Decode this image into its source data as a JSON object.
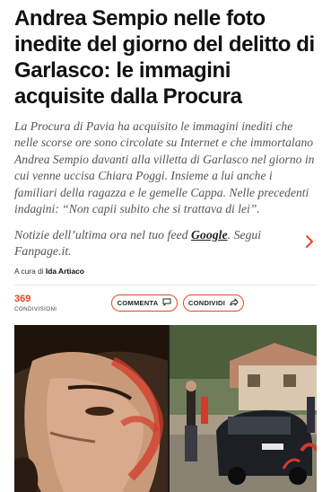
{
  "article": {
    "headline": "Andrea Sempio nelle foto inedite del giorno del delitto di Garlasco: le immagini acquisite dalla Procura",
    "summary": "La Procura di Pavia ha acquisito le immagini inediti che nelle scorse ore sono circolate su Internet e che immortalano Andrea Sempio davanti alla villetta di Garlasco nel giorno in cui venne uccisa Chiara Poggi. Insieme a lui anche i familiari della ragazza e le gemelle Cappa. Nelle precedenti indagini: “Non capii subito che si trattava di lei”.",
    "notify": {
      "prefix": "Notizie dell’ultima ora nel tuo feed ",
      "google": "Google",
      "suffix": ". Segui Fanpage.it."
    },
    "byline": {
      "prefix": "A cura di ",
      "author": "Ida Artiaco"
    }
  },
  "social": {
    "share_count": "369",
    "share_label": "CONDIVISIONI",
    "comment_label": "COMMENTA",
    "share_button_label": "CONDIVIDI"
  },
  "colors": {
    "accent": "#e7461f"
  },
  "icons": {
    "chevron": "chevron-right-icon",
    "comment": "comment-bubble-icon",
    "share": "share-arrow-icon"
  }
}
